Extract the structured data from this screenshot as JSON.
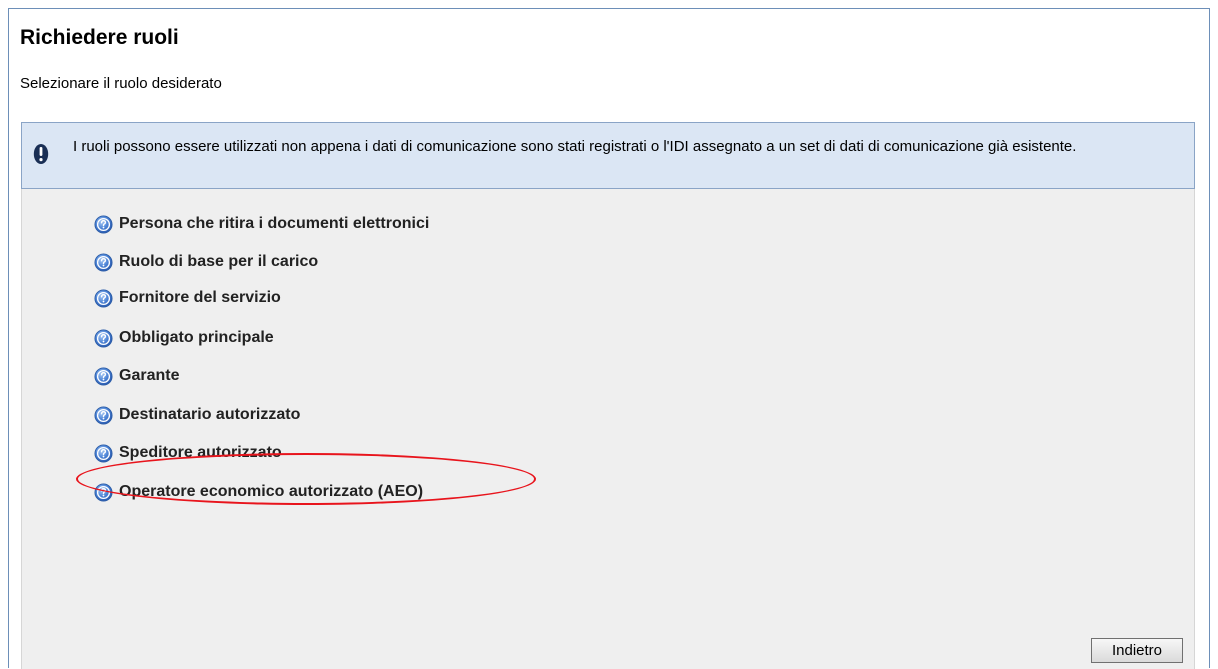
{
  "header": {
    "title": "Richiedere ruoli",
    "subtitle": "Selezionare il ruolo desiderato"
  },
  "info": {
    "icon": "exclamation-info-icon",
    "text": "I ruoli possono essere utilizzati non appena i dati di comunicazione sono stati registrati o l'IDI assegnato a un set di dati di comunicazione già esistente."
  },
  "roles": [
    {
      "label": "Persona che ritira i documenti elettronici",
      "icon": "help-icon"
    },
    {
      "label": "Ruolo di base per il carico",
      "icon": "help-icon"
    },
    {
      "label": "Fornitore del servizio",
      "icon": "help-icon"
    },
    {
      "label": "Obbligato principale",
      "icon": "help-icon"
    },
    {
      "label": "Garante",
      "icon": "help-icon"
    },
    {
      "label": "Destinatario autorizzato",
      "icon": "help-icon"
    },
    {
      "label": "Speditore autorizzato",
      "icon": "help-icon"
    },
    {
      "label": "Operatore economico autorizzato (AEO)",
      "icon": "help-icon",
      "highlighted": true
    }
  ],
  "footer": {
    "back_label": "Indietro"
  },
  "colors": {
    "info_background": "#dbe6f4",
    "content_background": "#efefef",
    "highlight_ring": "#e8141c",
    "help_icon_blue": "#3a6fc9"
  }
}
